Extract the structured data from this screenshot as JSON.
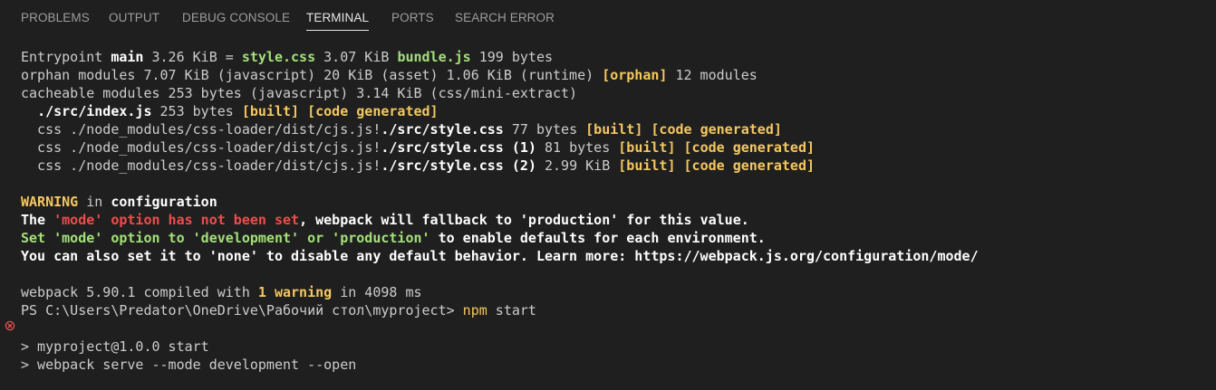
{
  "tabs": [
    {
      "label": "PROBLEMS"
    },
    {
      "label": "OUTPUT"
    },
    {
      "label": "DEBUG CONSOLE"
    },
    {
      "label": "TERMINAL",
      "active": true
    },
    {
      "label": "PORTS"
    },
    {
      "label": "SEARCH ERROR"
    }
  ],
  "terminal": {
    "l1": {
      "a": "Entrypoint ",
      "b": "main",
      "c": " 3.26 KiB = ",
      "d": "style.css",
      "e": " 3.07 KiB ",
      "f": "bundle.js",
      "g": " 199 bytes"
    },
    "l2": {
      "a": "orphan modules 7.07 KiB (javascript) 20 KiB (asset) 1.06 KiB (runtime) ",
      "b": "[orphan]",
      "c": " 12 modules"
    },
    "l3": {
      "a": "cacheable modules 253 bytes (javascript) 3.14 KiB (css/mini-extract)"
    },
    "l4": {
      "a": "  ",
      "b": "./src/index.js",
      "c": " 253 bytes ",
      "d": "[built]",
      "e": " ",
      "f": "[code generated]"
    },
    "l5": {
      "a": "  css ./node_modules/css-loader/dist/cjs.js!",
      "b": "./src/style.css",
      "c": " 77 bytes ",
      "d": "[built]",
      "e": " ",
      "f": "[code generated]"
    },
    "l6": {
      "a": "  css ./node_modules/css-loader/dist/cjs.js!",
      "b": "./src/style.css (1)",
      "c": " 81 bytes ",
      "d": "[built]",
      "e": " ",
      "f": "[code generated]"
    },
    "l7": {
      "a": "  css ./node_modules/css-loader/dist/cjs.js!",
      "b": "./src/style.css (2)",
      "c": " 2.99 KiB ",
      "d": "[built]",
      "e": " ",
      "f": "[code generated]"
    },
    "l8": {
      "a": "WARNING",
      "b": " in ",
      "c": "configuration"
    },
    "l9": {
      "a": "The ",
      "b": "'mode' option has not been set",
      "c": ", webpack will fallback to 'production' for this value."
    },
    "l10": {
      "a": "Set 'mode' option to 'development' or 'production'",
      "b": " to enable defaults for each environment."
    },
    "l11": {
      "a": "You can also set it to 'none' to disable any default behavior. Learn more: https://webpack.js.org/configuration/mode/"
    },
    "l12": {
      "a": "webpack 5.90.1 compiled with ",
      "b": "1 warning",
      "c": " in 4098 ms"
    },
    "l13": {
      "a": "PS C:\\Users\\Predator\\OneDrive\\Рабочий стол\\myproject> ",
      "b": "npm",
      "c": " start"
    },
    "l14": {
      "a": "> myproject@1.0.0 start"
    },
    "l15": {
      "a": "> webpack serve --mode development --open"
    }
  },
  "colors": {
    "background": "#1f1f1f",
    "text": "#cccccc",
    "highlight_yellow": "#f5c75f",
    "green": "#a3e07a",
    "red": "#f14c4c",
    "error_icon": "#f14c4c"
  },
  "icons": {
    "error_icon": "error-circle-x"
  }
}
